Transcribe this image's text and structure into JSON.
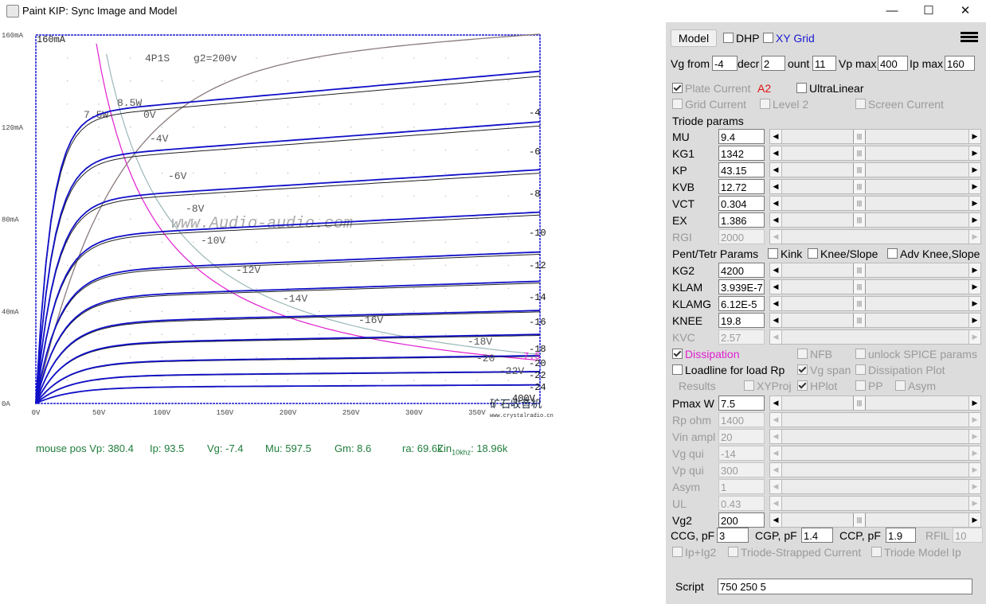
{
  "window": {
    "title": "Paint KIP: Sync Image and Model",
    "minimize": "—",
    "maximize": "☐",
    "close": "✕"
  },
  "plot": {
    "y_ticks": [
      "160mA",
      "120mA",
      "80mA",
      "40mA",
      "0A"
    ],
    "x_ticks": [
      "0V",
      "50V",
      "100V",
      "150V",
      "200V",
      "250V",
      "300V",
      "350V"
    ],
    "x_tick_vals": [
      0,
      50,
      100,
      150,
      200,
      250,
      300,
      350
    ],
    "y_tick_vals": [
      160,
      120,
      80,
      40,
      0
    ],
    "corner_label": "160mA",
    "tube_label": "4P1S",
    "g2_label": "g2=200v",
    "watermark": "www.Audio-audio.com",
    "logo_text": "矿石收音机",
    "logo_url": "www.crystalradio.cn",
    "power_labels": [
      "8.5W",
      "7.5W"
    ],
    "end_label": "400V",
    "curve_labels": [
      "0V",
      "-4V",
      "-6V",
      "-8V",
      "-10V",
      "-12V",
      "-14V",
      "-16V",
      "-18V",
      "-20",
      "-22V"
    ],
    "model_labels": [
      "-4",
      "-6",
      "-8",
      "-10",
      "-12",
      "-14",
      "-16",
      "-18",
      "-20",
      "-22",
      "-24"
    ],
    "dissip_label": "7.5"
  },
  "status": {
    "mouse_pos": "mouse pos Vp: 380.4",
    "ip": "Ip: 93.5",
    "vg": "Vg: -7.4",
    "mu": "Mu: 597.5",
    "gm": "Gm: 8.6",
    "ra": "ra: 69.6k",
    "zin_label": "Zin",
    "zin_sub": "10khz",
    "zin_val": ": 18.96k"
  },
  "panel": {
    "model_button": "Model",
    "dhp": "DHP",
    "xy_grid": "XY Grid",
    "vg_from_label": "Vg from",
    "vg_from": "-4",
    "decr_label": "decr",
    "decr": "2",
    "count_label": "ount",
    "count": "11",
    "vp_max_label": "Vp max",
    "vp_max": "400",
    "ip_max_label": "Ip max",
    "ip_max": "160",
    "plate_current": "Plate Current",
    "a2": "A2",
    "ultralinear": "UltraLinear",
    "grid_current": "Grid Current",
    "level2": "Level 2",
    "screen_current": "Screen Current",
    "triode_params": "Triode params",
    "triode": [
      {
        "label": "MU",
        "value": "9.4"
      },
      {
        "label": "KG1",
        "value": "1342"
      },
      {
        "label": "KP",
        "value": "43.15"
      },
      {
        "label": "KVB",
        "value": "12.72"
      },
      {
        "label": "VCT",
        "value": "0.304"
      },
      {
        "label": "EX",
        "value": "1.386"
      },
      {
        "label": "RGI",
        "value": "2000"
      }
    ],
    "pent_params": "Pent/Tetr Params",
    "kink": "Kink",
    "knee_slope": "Knee/Slope",
    "adv_knee": "Adv Knee,Slope",
    "pent": [
      {
        "label": "KG2",
        "value": "4200"
      },
      {
        "label": "KLAM",
        "value": "3.939E-7"
      },
      {
        "label": "KLAMG",
        "value": "6.12E-5"
      },
      {
        "label": "KNEE",
        "value": "19.8"
      },
      {
        "label": "KVC",
        "value": "2.57"
      }
    ],
    "dissipation": "Dissipation",
    "nfb": "NFB",
    "unlock_spice": "unlock SPICE params",
    "loadline": "Loadline for load Rp",
    "vg_span": "Vg span",
    "dissipation_plot": "Dissipation Plot",
    "results": "Results",
    "xyproj": "XYProj",
    "hplot": "HPlot",
    "pp": "PP",
    "asym_cb": "Asym",
    "load": [
      {
        "label": "Pmax W",
        "value": "7.5"
      },
      {
        "label": "Rp ohm",
        "value": "1400"
      },
      {
        "label": "Vin ampl",
        "value": "20"
      },
      {
        "label": "Vg qui",
        "value": "-14"
      },
      {
        "label": "Vp qui",
        "value": "300"
      },
      {
        "label": "Asym",
        "value": "1"
      },
      {
        "label": "UL",
        "value": "0.43"
      },
      {
        "label": "Vg2",
        "value": "200"
      }
    ],
    "ccg_label": "CCG, pF",
    "ccg": "3",
    "cgp_label": "CGP, pF",
    "cgp": "1.4",
    "ccp_label": "CCP, pF",
    "ccp": "1.9",
    "rfil_label": "RFIL",
    "rfil": "10",
    "ip_ig2": "Ip+Ig2",
    "triode_strapped": "Triode-Strapped Current",
    "triode_model_ip": "Triode Model Ip",
    "script_label": "Script",
    "script": "750 250 5"
  },
  "colors": {
    "model_curve": "#1010c8",
    "dissip": "#e020d0",
    "status_text": "#1f7d3c",
    "a2": "#e01010",
    "xy_grid": "#1a1ad0"
  }
}
